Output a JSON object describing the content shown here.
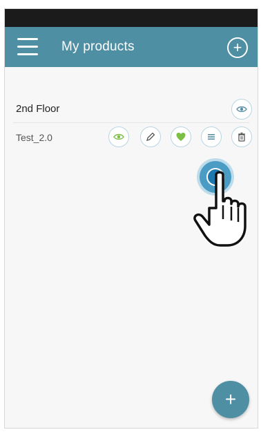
{
  "header": {
    "title": "My products",
    "menu_icon": "hamburger-menu-icon",
    "add_icon": "plus-circle-icon"
  },
  "floor": {
    "label": "2nd Floor",
    "action_icon": "eye-icon"
  },
  "product": {
    "label": "Test_2.0",
    "actions": [
      "eye-icon",
      "pencil-icon",
      "heart-icon",
      "list-icon",
      "trash-icon"
    ]
  },
  "fab": {
    "label": "+",
    "icon": "plus-icon"
  },
  "colors": {
    "header": "#4f8fa3",
    "accent_green": "#7bbf45",
    "button_border": "#b9d4e1",
    "status_bar": "#1b1b1b"
  }
}
